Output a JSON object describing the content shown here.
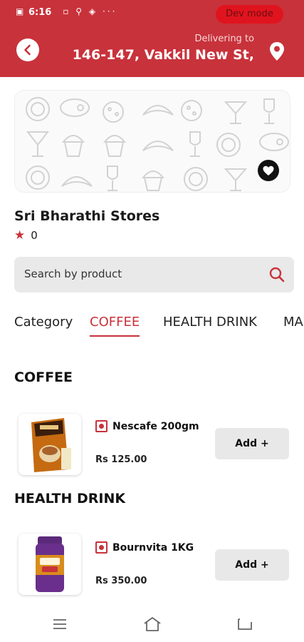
{
  "status_bar": {
    "time": "6:16",
    "dev_badge": "Dev mode"
  },
  "header": {
    "delivering_label": "Delivering to",
    "address": "146-147, Vakkil New St,"
  },
  "store": {
    "name": "Sri Bharathi Stores",
    "rating": "0"
  },
  "search": {
    "placeholder": "Search by product"
  },
  "categories": {
    "label": "Category",
    "tabs": [
      "COFFEE",
      "HEALTH DRINK",
      "MA"
    ]
  },
  "sections": [
    {
      "title": "COFFEE",
      "products": [
        {
          "name": "Nescafe 200gm",
          "price": "Rs 125.00",
          "add_label": "Add +"
        }
      ]
    },
    {
      "title": "HEALTH DRINK",
      "products": [
        {
          "name": "Bournvita 1KG",
          "price": "Rs 350.00",
          "add_label": "Add +"
        }
      ]
    }
  ],
  "colors": {
    "brand": "#c8323b",
    "dev_badge": "#e0141e"
  },
  "icons": [
    "back-arrow-icon",
    "location-pin-icon",
    "heart-icon",
    "search-icon",
    "menu-icon",
    "home-icon",
    "back-nav-icon",
    "star-icon",
    "veg-indicator-icon"
  ]
}
